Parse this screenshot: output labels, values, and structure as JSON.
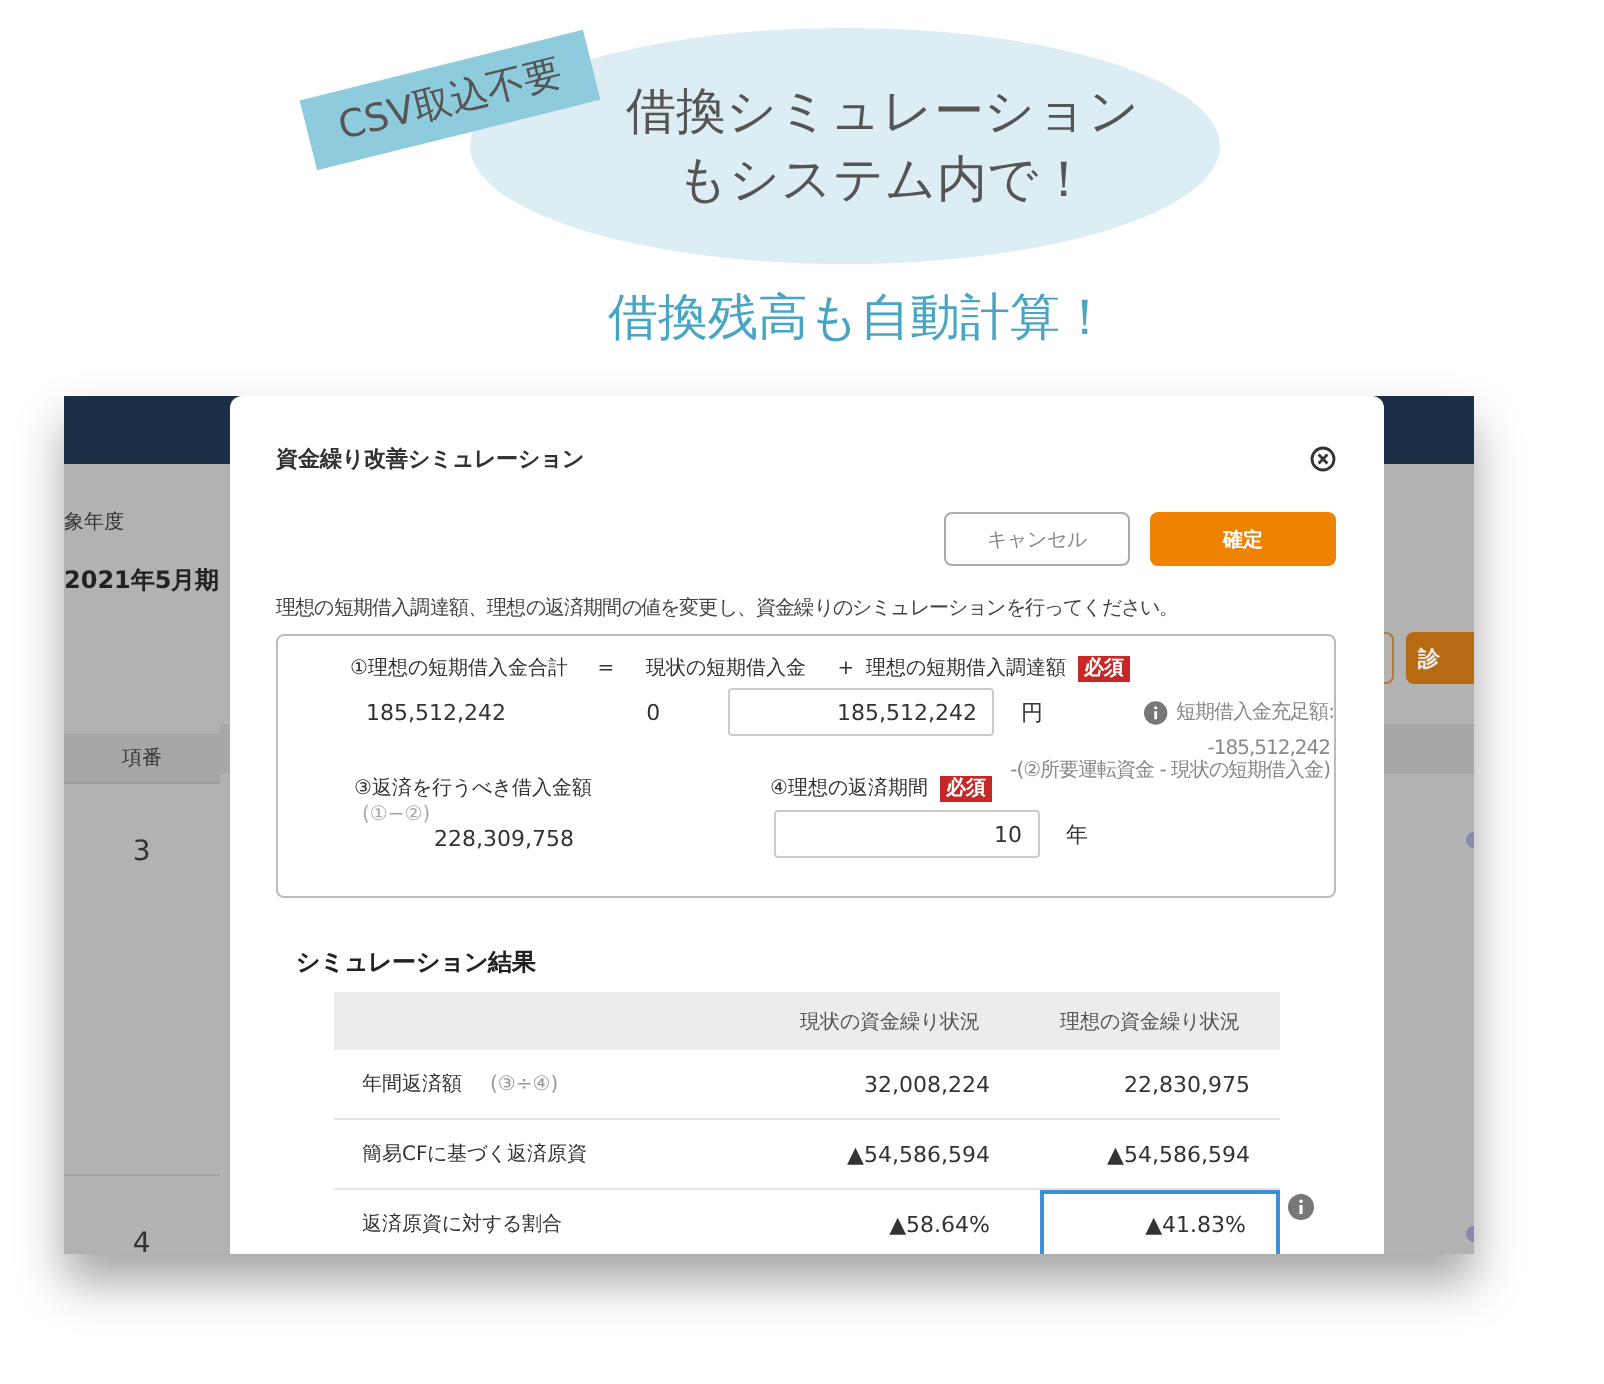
{
  "promo": {
    "tag": "CSV取込不要",
    "bubble_lines": [
      "借換シミュレーション",
      "もシステム内で！"
    ],
    "subheading": "借換残高も自動計算！"
  },
  "background_app": {
    "period_label": "象年度",
    "period": "2021年5月期",
    "column_header": "項番",
    "row_numbers": [
      "3",
      "4"
    ],
    "button": "診"
  },
  "modal": {
    "title": "資金繰り改善シミュレーション",
    "buttons": [
      {
        "label": "キャンセル",
        "kind": "secondary"
      },
      {
        "label": "確定",
        "kind": "primary"
      }
    ],
    "description": "理想の短期借入調達額、理想の返済期間の値を変更し、資金繰りのシミュレーションを行ってください。",
    "form": {
      "total_label": "①理想の短期借入金合計",
      "equals": "=",
      "current_label": "現状の短期借入金",
      "plus": "+",
      "ideal": {
        "label": "理想の短期借入調達額",
        "badge": "必須",
        "value": "185,512,242",
        "unit": "円"
      },
      "total_value": "185,512,242",
      "current_value": "0",
      "note_label": "短期借入金充足額:",
      "note_value": "-185,512,242",
      "note_formula": "-(②所要運転資金 - 現状の短期借入金)",
      "repay_label": "③返済を行うべき借入金額",
      "repay_formula": "(①−②)",
      "repay_value": "228,309,758",
      "period": {
        "label": "④理想の返済期間",
        "badge": "必須",
        "value": "10",
        "unit": "年"
      }
    },
    "results": {
      "title": "シミュレーション結果",
      "columns": [
        "現状の資金繰り状況",
        "理想の資金繰り状況"
      ],
      "rows": [
        {
          "label": "年間返済額",
          "note": "(③÷④)",
          "current": "32,008,224",
          "ideal": "22,830,975",
          "highlighted": false,
          "info_icon": false
        },
        {
          "label": "簡易CFに基づく返済原資",
          "current": "▲54,586,594",
          "ideal": "▲54,586,594",
          "highlighted": false,
          "info_icon": false
        },
        {
          "label": "返済原資に対する割合",
          "current": "▲58.64%",
          "ideal": "▲41.83%",
          "highlighted": true,
          "info_icon": true
        }
      ]
    }
  }
}
